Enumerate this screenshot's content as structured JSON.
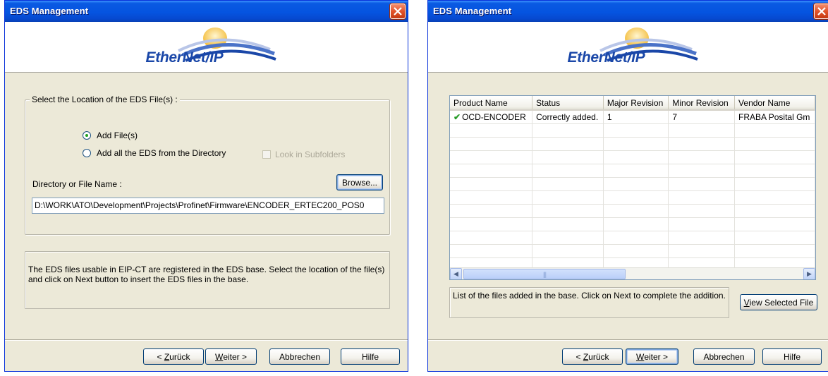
{
  "left_dialog": {
    "title": "EDS Management",
    "logo_text": "EtherNet/IP",
    "group_label": "Select the Location of the EDS File(s) :",
    "options": {
      "add_files": "Add File(s)",
      "add_directory": "Add all the EDS from the Directory",
      "subfolders": "Look in Subfolders"
    },
    "selected_option": "add_files",
    "path_label": "Directory or File Name :",
    "browse_button": "Browse...",
    "path_value": "D:\\WORK\\ATO\\Development\\Projects\\Profinet\\Firmware\\ENCODER_ERTEC200_POS0",
    "info_text": "The EDS files usable in EIP-CT are registered in the EDS base. Select the location of the file(s) and click on Next button to insert the EDS files in the base.",
    "buttons": {
      "back_lt": "< ",
      "back_acc": "Z",
      "back_rest": "urück",
      "next_acc": "W",
      "next_rest": "eiter >",
      "cancel": "Abbrechen",
      "help": "Hilfe"
    }
  },
  "right_dialog": {
    "title": "EDS Management",
    "logo_text": "EtherNet/IP",
    "table": {
      "columns": [
        "Product Name",
        "Status",
        "Major Revision",
        "Minor Revision",
        "Vendor Name"
      ],
      "rows": [
        [
          "OCD-ENCODER",
          "Correctly added.",
          "1",
          "7",
          "FRABA Posital Gm"
        ]
      ],
      "row_status_icon": "green-check-icon"
    },
    "info_text": "List of the files added in the base. Click on Next to complete the addition.",
    "view_button_acc": "V",
    "view_button_rest": "iew Selected File",
    "buttons": {
      "back_lt": "< ",
      "back_acc": "Z",
      "back_rest": "urück",
      "next_acc": "W",
      "next_rest": "eiter >",
      "cancel": "Abbrechen",
      "help": "Hilfe"
    }
  },
  "colors": {
    "titlebar": "#0554e0",
    "dialog_bg": "#ece9d8",
    "logo_blue": "#1a47a8",
    "logo_sun": "#f5c04a",
    "check_green": "#2a9d2a",
    "close_red": "#e2532b"
  }
}
